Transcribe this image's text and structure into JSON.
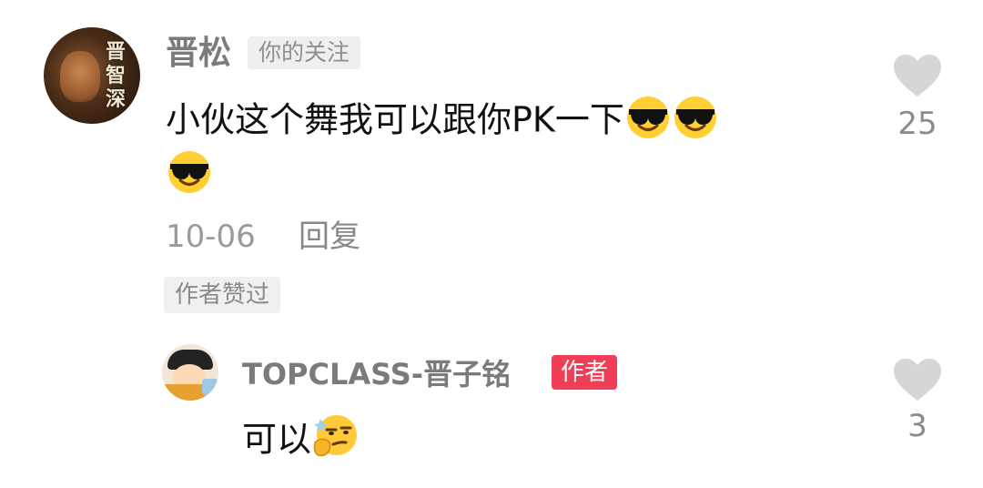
{
  "comment": {
    "username": "晋松",
    "follow_tag": "你的关注",
    "text_line1": "小伙这个舞我可以跟你PK一下",
    "date": "10-06",
    "reply_label": "回复",
    "author_liked_badge": "作者赞过",
    "like_count": "25",
    "avatar_caption": "晋智深",
    "emojis": [
      "sunglasses-emoji",
      "sunglasses-emoji",
      "sunglasses-emoji"
    ]
  },
  "reply": {
    "username": "TOPCLASS-晋子铭",
    "author_badge": "作者",
    "text": "可以",
    "like_count": "3",
    "emojis": [
      "smirk-thinking-emoji"
    ]
  },
  "colors": {
    "author_badge": "#ef3e55",
    "heart": "#d6d6d6",
    "meta_text": "#9a9a9a",
    "username_text": "#7b7b7b"
  }
}
